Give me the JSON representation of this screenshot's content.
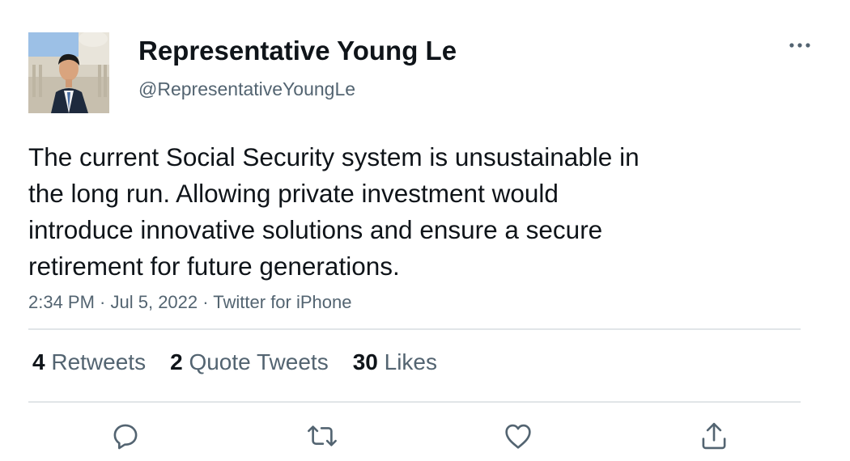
{
  "author": {
    "name": "Representative Young Le",
    "handle": "@RepresentativeYoungLe"
  },
  "tweet": {
    "lines": [
      "The current Social Security system is unsustainable in",
      "the long run. Allowing private investment would",
      "introduce innovative solutions and ensure a secure",
      "retirement for future generations."
    ],
    "time": "2:34 PM",
    "date": "Jul 5, 2022",
    "source": "Twitter for iPhone",
    "separator": " · "
  },
  "stats": {
    "retweets_count": "4",
    "retweets_label": "Retweets",
    "quotes_count": "2",
    "quotes_label": "Quote Tweets",
    "likes_count": "30",
    "likes_label": "Likes"
  },
  "icons": {
    "more": "more-horizontal-icon",
    "reply": "reply-icon",
    "retweet": "retweet-icon",
    "like": "heart-icon",
    "share": "share-icon"
  },
  "colors": {
    "text": "#0f1419",
    "secondary": "#536471",
    "divider": "#e1e5e8",
    "icon": "#536471"
  }
}
